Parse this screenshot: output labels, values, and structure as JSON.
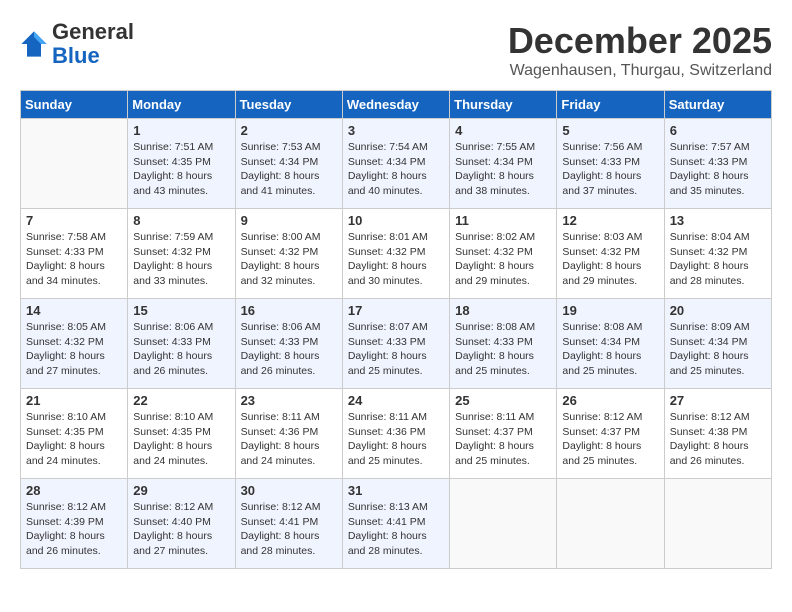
{
  "header": {
    "logo_line1": "General",
    "logo_line2": "Blue",
    "month": "December 2025",
    "location": "Wagenhausen, Thurgau, Switzerland"
  },
  "days_of_week": [
    "Sunday",
    "Monday",
    "Tuesday",
    "Wednesday",
    "Thursday",
    "Friday",
    "Saturday"
  ],
  "weeks": [
    [
      {
        "num": "",
        "info": ""
      },
      {
        "num": "1",
        "info": "Sunrise: 7:51 AM\nSunset: 4:35 PM\nDaylight: 8 hours\nand 43 minutes."
      },
      {
        "num": "2",
        "info": "Sunrise: 7:53 AM\nSunset: 4:34 PM\nDaylight: 8 hours\nand 41 minutes."
      },
      {
        "num": "3",
        "info": "Sunrise: 7:54 AM\nSunset: 4:34 PM\nDaylight: 8 hours\nand 40 minutes."
      },
      {
        "num": "4",
        "info": "Sunrise: 7:55 AM\nSunset: 4:34 PM\nDaylight: 8 hours\nand 38 minutes."
      },
      {
        "num": "5",
        "info": "Sunrise: 7:56 AM\nSunset: 4:33 PM\nDaylight: 8 hours\nand 37 minutes."
      },
      {
        "num": "6",
        "info": "Sunrise: 7:57 AM\nSunset: 4:33 PM\nDaylight: 8 hours\nand 35 minutes."
      }
    ],
    [
      {
        "num": "7",
        "info": "Sunrise: 7:58 AM\nSunset: 4:33 PM\nDaylight: 8 hours\nand 34 minutes."
      },
      {
        "num": "8",
        "info": "Sunrise: 7:59 AM\nSunset: 4:32 PM\nDaylight: 8 hours\nand 33 minutes."
      },
      {
        "num": "9",
        "info": "Sunrise: 8:00 AM\nSunset: 4:32 PM\nDaylight: 8 hours\nand 32 minutes."
      },
      {
        "num": "10",
        "info": "Sunrise: 8:01 AM\nSunset: 4:32 PM\nDaylight: 8 hours\nand 30 minutes."
      },
      {
        "num": "11",
        "info": "Sunrise: 8:02 AM\nSunset: 4:32 PM\nDaylight: 8 hours\nand 29 minutes."
      },
      {
        "num": "12",
        "info": "Sunrise: 8:03 AM\nSunset: 4:32 PM\nDaylight: 8 hours\nand 29 minutes."
      },
      {
        "num": "13",
        "info": "Sunrise: 8:04 AM\nSunset: 4:32 PM\nDaylight: 8 hours\nand 28 minutes."
      }
    ],
    [
      {
        "num": "14",
        "info": "Sunrise: 8:05 AM\nSunset: 4:32 PM\nDaylight: 8 hours\nand 27 minutes."
      },
      {
        "num": "15",
        "info": "Sunrise: 8:06 AM\nSunset: 4:33 PM\nDaylight: 8 hours\nand 26 minutes."
      },
      {
        "num": "16",
        "info": "Sunrise: 8:06 AM\nSunset: 4:33 PM\nDaylight: 8 hours\nand 26 minutes."
      },
      {
        "num": "17",
        "info": "Sunrise: 8:07 AM\nSunset: 4:33 PM\nDaylight: 8 hours\nand 25 minutes."
      },
      {
        "num": "18",
        "info": "Sunrise: 8:08 AM\nSunset: 4:33 PM\nDaylight: 8 hours\nand 25 minutes."
      },
      {
        "num": "19",
        "info": "Sunrise: 8:08 AM\nSunset: 4:34 PM\nDaylight: 8 hours\nand 25 minutes."
      },
      {
        "num": "20",
        "info": "Sunrise: 8:09 AM\nSunset: 4:34 PM\nDaylight: 8 hours\nand 25 minutes."
      }
    ],
    [
      {
        "num": "21",
        "info": "Sunrise: 8:10 AM\nSunset: 4:35 PM\nDaylight: 8 hours\nand 24 minutes."
      },
      {
        "num": "22",
        "info": "Sunrise: 8:10 AM\nSunset: 4:35 PM\nDaylight: 8 hours\nand 24 minutes."
      },
      {
        "num": "23",
        "info": "Sunrise: 8:11 AM\nSunset: 4:36 PM\nDaylight: 8 hours\nand 24 minutes."
      },
      {
        "num": "24",
        "info": "Sunrise: 8:11 AM\nSunset: 4:36 PM\nDaylight: 8 hours\nand 25 minutes."
      },
      {
        "num": "25",
        "info": "Sunrise: 8:11 AM\nSunset: 4:37 PM\nDaylight: 8 hours\nand 25 minutes."
      },
      {
        "num": "26",
        "info": "Sunrise: 8:12 AM\nSunset: 4:37 PM\nDaylight: 8 hours\nand 25 minutes."
      },
      {
        "num": "27",
        "info": "Sunrise: 8:12 AM\nSunset: 4:38 PM\nDaylight: 8 hours\nand 26 minutes."
      }
    ],
    [
      {
        "num": "28",
        "info": "Sunrise: 8:12 AM\nSunset: 4:39 PM\nDaylight: 8 hours\nand 26 minutes."
      },
      {
        "num": "29",
        "info": "Sunrise: 8:12 AM\nSunset: 4:40 PM\nDaylight: 8 hours\nand 27 minutes."
      },
      {
        "num": "30",
        "info": "Sunrise: 8:12 AM\nSunset: 4:41 PM\nDaylight: 8 hours\nand 28 minutes."
      },
      {
        "num": "31",
        "info": "Sunrise: 8:13 AM\nSunset: 4:41 PM\nDaylight: 8 hours\nand 28 minutes."
      },
      {
        "num": "",
        "info": ""
      },
      {
        "num": "",
        "info": ""
      },
      {
        "num": "",
        "info": ""
      }
    ]
  ]
}
